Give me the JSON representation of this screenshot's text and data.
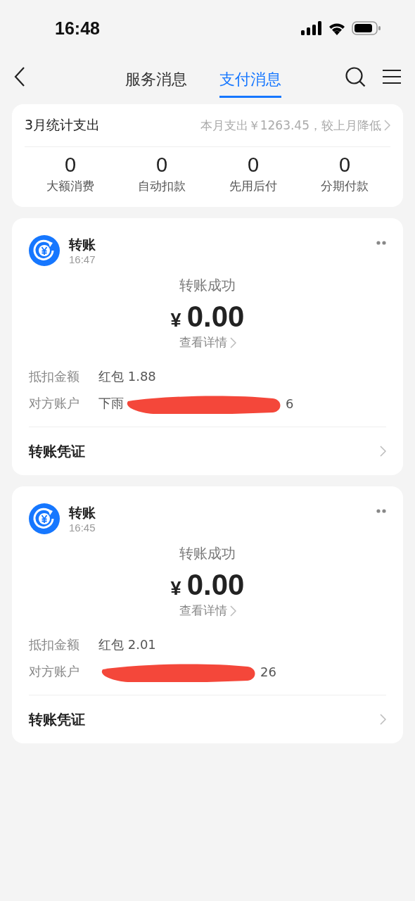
{
  "status_bar": {
    "time": "16:48"
  },
  "nav": {
    "tabs": [
      {
        "label": "服务消息",
        "selected": false
      },
      {
        "label": "支付消息",
        "selected": true
      }
    ]
  },
  "summary": {
    "title": "3月统计支出",
    "note": "本月支出￥1263.45，较上月降低",
    "stats": [
      {
        "value": "0",
        "label": "大额消费"
      },
      {
        "value": "0",
        "label": "自动扣款"
      },
      {
        "value": "0",
        "label": "先用后付"
      },
      {
        "value": "0",
        "label": "分期付款"
      }
    ]
  },
  "messages": [
    {
      "title": "转账",
      "time": "16:47",
      "status": "转账成功",
      "currency": "¥",
      "amount": "0.00",
      "details_link": "查看详情",
      "fields": [
        {
          "label": "抵扣金额",
          "value": "红包 1.88"
        },
        {
          "label": "对方账户",
          "value": "下雨",
          "value_end": "6",
          "redacted": true
        }
      ],
      "footer": "转账凭证"
    },
    {
      "title": "转账",
      "time": "16:45",
      "status": "转账成功",
      "currency": "¥",
      "amount": "0.00",
      "details_link": "查看详情",
      "fields": [
        {
          "label": "抵扣金额",
          "value": "红包 2.01"
        },
        {
          "label": "对方账户",
          "value_end": "26",
          "redacted": true
        }
      ],
      "footer": "转账凭证"
    }
  ]
}
